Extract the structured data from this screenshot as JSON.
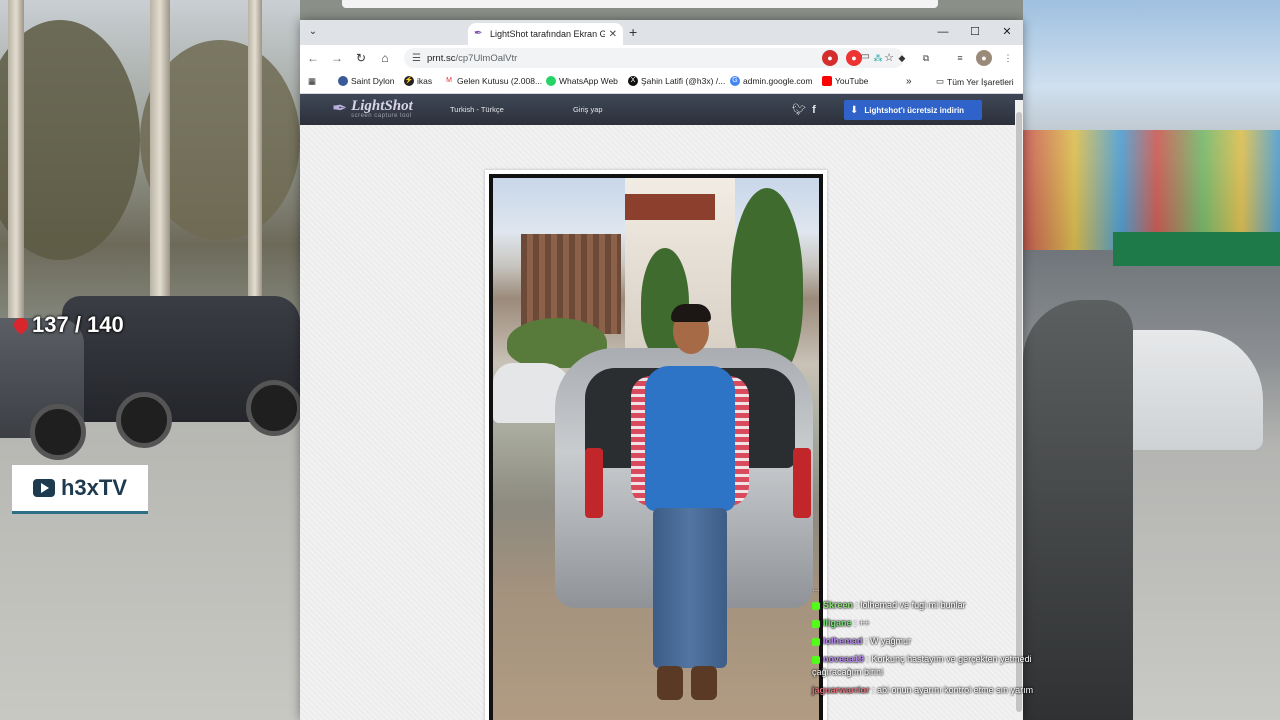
{
  "overlay": {
    "counter": "137 / 140",
    "brand_name": "h3xTV"
  },
  "browser": {
    "tab_title": "LightShot tarafından Ekran Gör",
    "url_host": "prnt.sc",
    "url_path": "/cp7UlmOalVtr",
    "bookmarks": [
      {
        "label": "Saint Dylon"
      },
      {
        "label": "ikas"
      },
      {
        "label": "Gelen Kutusu (2.008..."
      },
      {
        "label": "WhatsApp Web"
      },
      {
        "label": "Şahin Latifi (@h3x) /..."
      },
      {
        "label": "admin.google.com"
      },
      {
        "label": "YouTube"
      },
      {
        "label": "Tüm Yer İşaretleri"
      }
    ]
  },
  "lightshot": {
    "logo_text": "LightShot",
    "logo_sub": "screen capture tool",
    "language": "Turkish - Türkçe",
    "login": "Giriş yap",
    "download": "Lightshot'ı ücretsiz indirin"
  },
  "chat": [
    {
      "user": "Skreen",
      "text": ": lolhemad ve fugi mi bunlar",
      "color": "#8fe07a"
    },
    {
      "user": "lligane",
      "text": ": ++",
      "color": "#7ae07a"
    },
    {
      "user": "lolhemad",
      "text": ": W yağmur",
      "color": "#b98cf0"
    },
    {
      "user": "noveaa19",
      "text": ": Korkunç hastayım ve gerçekten yetmedi çağıracağım birini",
      "color": "#b98cf0"
    },
    {
      "user": "jaguarwarrior",
      "text": ": abi onun ayarını kontrol etme sın yarım",
      "color": "#e0707a"
    }
  ],
  "colors": {
    "lightshot_header": "#2b303a",
    "download_button": "#2f63c9",
    "brand_accent": "#2d6f86"
  }
}
